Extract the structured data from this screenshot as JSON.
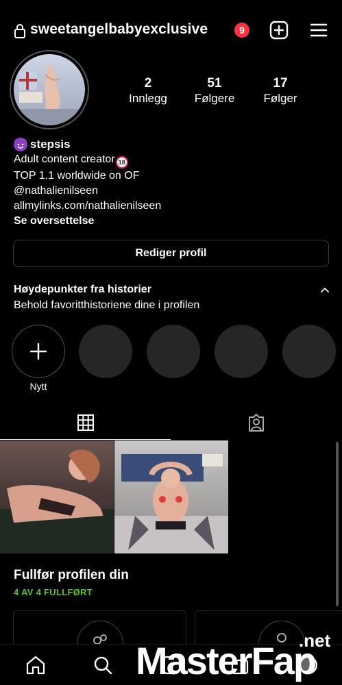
{
  "header": {
    "username": "sweetangelbabyexclusive",
    "notification_count": "9",
    "icons": {
      "lock": "lock-icon",
      "add": "plus-square-icon",
      "menu": "hamburger-menu-icon"
    }
  },
  "profile": {
    "stats": [
      {
        "value": "2",
        "label": "Innlegg"
      },
      {
        "value": "51",
        "label": "Følgere"
      },
      {
        "value": "17",
        "label": "Følger"
      }
    ],
    "bio": {
      "name": "stepsis",
      "name_emoji": "smiling-devil-emoji",
      "line1": "Adult content creator",
      "line1_emoji": "18",
      "line2": "TOP 1.1 worldwide on OF",
      "line3": "@nathalienilseen",
      "line4": "allmylinks.com/nathalienilseen",
      "translate": "Se oversettelse"
    },
    "edit_button": "Rediger profil"
  },
  "highlights": {
    "title": "Høydepunkter fra historier",
    "subtitle": "Behold favoritthistoriene dine i profilen",
    "new_label": "Nytt"
  },
  "tabs": [
    {
      "name": "posts-grid",
      "icon": "grid-icon",
      "active": true
    },
    {
      "name": "tagged",
      "icon": "tagged-person-icon",
      "active": false
    }
  ],
  "complete_profile": {
    "title": "Fullfør profilen din",
    "progress_done": "4 AV 4",
    "progress_label": "FULLFØRT"
  },
  "bottom_nav": [
    "home-icon",
    "search-icon",
    "reels-icon",
    "shop-icon",
    "profile-icon"
  ],
  "watermark": {
    "main": "MasterFap",
    "suffix": ".net"
  },
  "colors": {
    "background": "#000000",
    "badge": "#ff3040",
    "progress": "#58c322",
    "highlight_placeholder": "#262626"
  }
}
